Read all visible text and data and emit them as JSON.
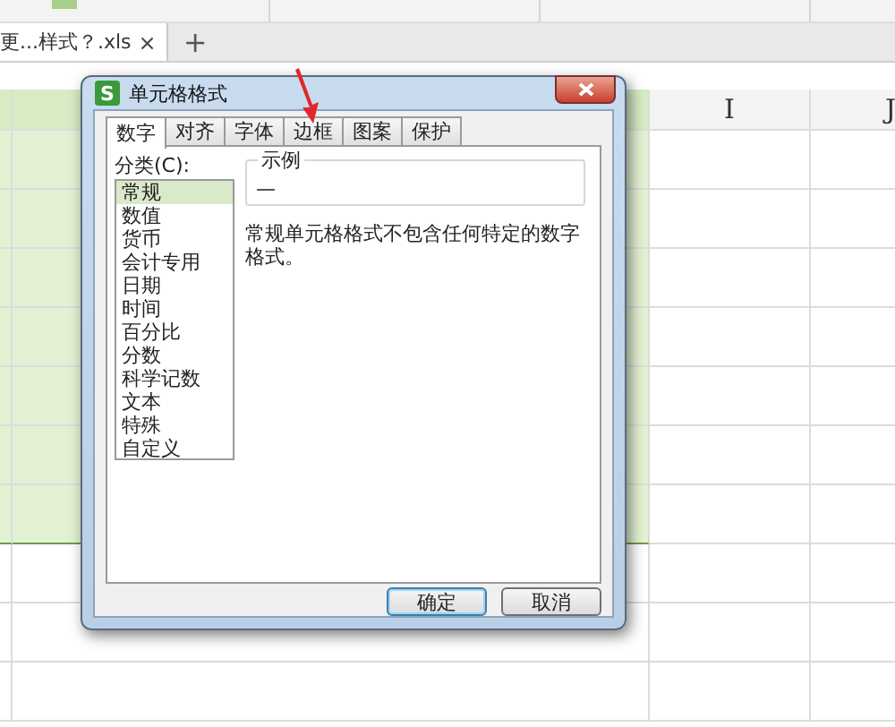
{
  "file_tab": {
    "label": "更...样式？.xls",
    "close": "×",
    "new": "+"
  },
  "sheet": {
    "column_headers": [
      "I",
      "J"
    ],
    "rows": [
      {
        "selected": true
      },
      {
        "selected": true
      },
      {
        "selected": true
      },
      {
        "selected": true
      },
      {
        "selected": true
      },
      {
        "selected": true
      },
      {
        "selected": true
      },
      {
        "selected": false
      },
      {
        "selected": false
      },
      {
        "selected": false
      }
    ]
  },
  "dialog": {
    "app_icon": "S",
    "title": "单元格格式",
    "tabs": [
      {
        "label": "数字",
        "selected": true
      },
      {
        "label": "对齐",
        "selected": false
      },
      {
        "label": "字体",
        "selected": false
      },
      {
        "label": "边框",
        "selected": false
      },
      {
        "label": "图案",
        "selected": false
      },
      {
        "label": "保护",
        "selected": false
      }
    ],
    "category_label": "分类(C):",
    "categories": [
      {
        "label": "常规",
        "selected": true
      },
      {
        "label": "数值",
        "selected": false
      },
      {
        "label": "货币",
        "selected": false
      },
      {
        "label": "会计专用",
        "selected": false
      },
      {
        "label": "日期",
        "selected": false
      },
      {
        "label": "时间",
        "selected": false
      },
      {
        "label": "百分比",
        "selected": false
      },
      {
        "label": "分数",
        "selected": false
      },
      {
        "label": "科学记数",
        "selected": false
      },
      {
        "label": "文本",
        "selected": false
      },
      {
        "label": "特殊",
        "selected": false
      },
      {
        "label": "自定义",
        "selected": false
      }
    ],
    "sample": {
      "title": "示例",
      "value": "—"
    },
    "description": "常规单元格格式不包含任何特定的数字格式。",
    "buttons": [
      {
        "label": "确定",
        "kind": "default"
      },
      {
        "label": "取消",
        "kind": "normal"
      }
    ]
  }
}
